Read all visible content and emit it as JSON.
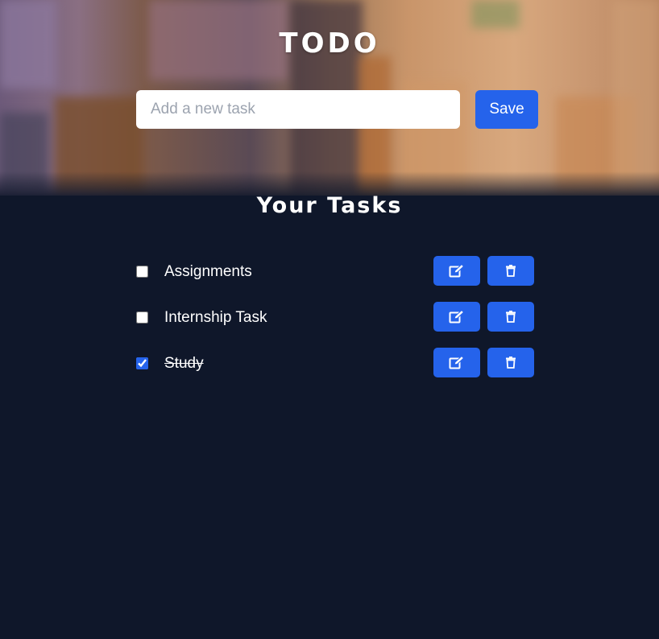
{
  "app": {
    "title": "TODO"
  },
  "new_task": {
    "placeholder": "Add a new task",
    "value": "",
    "save_label": "Save"
  },
  "tasks_section": {
    "heading": "Your Tasks"
  },
  "tasks": [
    {
      "text": "Assignments",
      "completed": false,
      "edit_icon": "edit-icon",
      "delete_icon": "trash-icon"
    },
    {
      "text": "Internship Task",
      "completed": false,
      "edit_icon": "edit-icon",
      "delete_icon": "trash-icon"
    },
    {
      "text": "Study",
      "completed": true,
      "edit_icon": "edit-icon",
      "delete_icon": "trash-icon"
    }
  ],
  "colors": {
    "accent": "#2563eb",
    "background": "#0f172a",
    "text": "#ffffff",
    "input_bg": "#ffffff",
    "placeholder": "#9ca3af"
  }
}
